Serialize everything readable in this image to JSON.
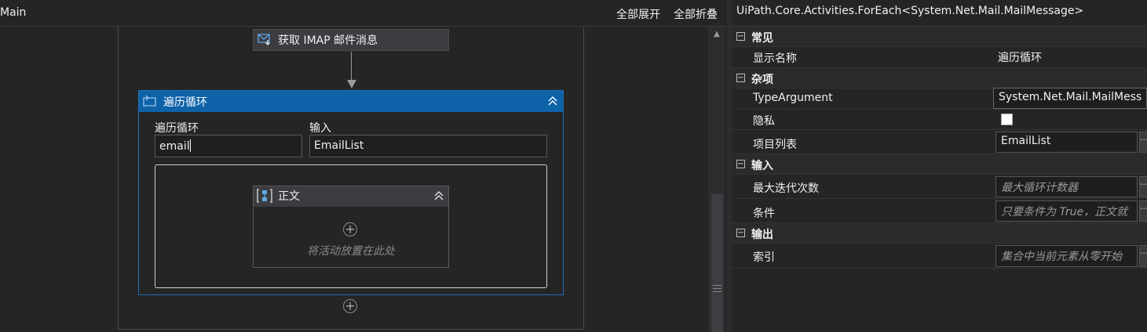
{
  "designer": {
    "tab_title": "Main",
    "expand_all": "全部展开",
    "collapse_all": "全部折叠",
    "imap_activity": {
      "label": "获取 IMAP 邮件消息"
    },
    "foreach": {
      "title": "遍历循环",
      "item_label": "遍历循环",
      "item_value": "email",
      "input_label": "输入",
      "input_value": "EmailList",
      "body": {
        "title": "正文",
        "drop_hint": "将活动放置在此处"
      }
    }
  },
  "properties": {
    "title": "UiPath.Core.Activities.ForEach<System.Net.Mail.MailMessage>",
    "categories": [
      {
        "label": "常见",
        "toggle": "−"
      },
      {
        "label": "杂项",
        "toggle": "−"
      },
      {
        "label": "输入",
        "toggle": "−"
      },
      {
        "label": "输出",
        "toggle": "−"
      }
    ],
    "rows": {
      "display_name": {
        "name": "显示名称",
        "value": "遍历循环"
      },
      "type_argument": {
        "name": "TypeArgument",
        "value": "System.Net.Mail.MailMess"
      },
      "private": {
        "name": "隐私",
        "checked": false
      },
      "values": {
        "name": "项目列表",
        "value": "EmailList",
        "ellipsis": "..."
      },
      "max_iterations": {
        "name": "最大迭代次数",
        "placeholder": "最大循环计数器",
        "ellipsis": "..."
      },
      "condition": {
        "name": "条件",
        "placeholder": "只要条件为 True，正文就",
        "ellipsis": "..."
      },
      "index": {
        "name": "索引",
        "placeholder": "集合中当前元素从零开始",
        "ellipsis": "..."
      }
    }
  }
}
